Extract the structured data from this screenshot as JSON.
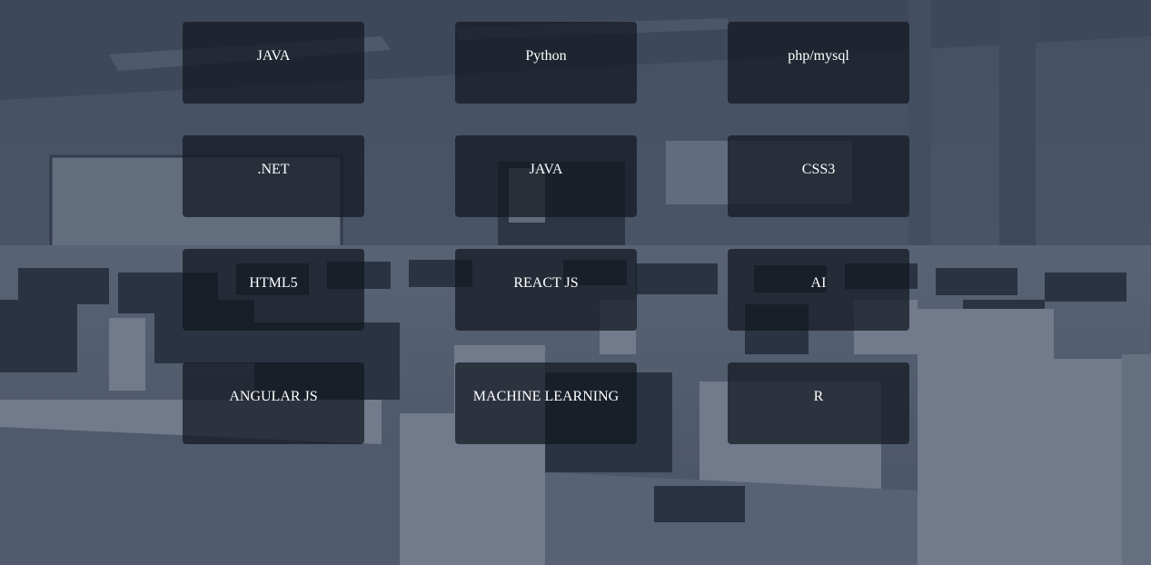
{
  "courses": [
    {
      "label": "JAVA"
    },
    {
      "label": "Python"
    },
    {
      "label": "php/mysql"
    },
    {
      "label": ".NET"
    },
    {
      "label": "JAVA"
    },
    {
      "label": "CSS3"
    },
    {
      "label": "HTML5"
    },
    {
      "label": "REACT JS"
    },
    {
      "label": "AI"
    },
    {
      "label": "ANGULAR JS"
    },
    {
      "label": "MACHINE LEARNING"
    },
    {
      "label": "R"
    }
  ],
  "colors": {
    "tile_background": "#14181f",
    "tile_text": "#ffffff",
    "background_tint": "#283448"
  }
}
